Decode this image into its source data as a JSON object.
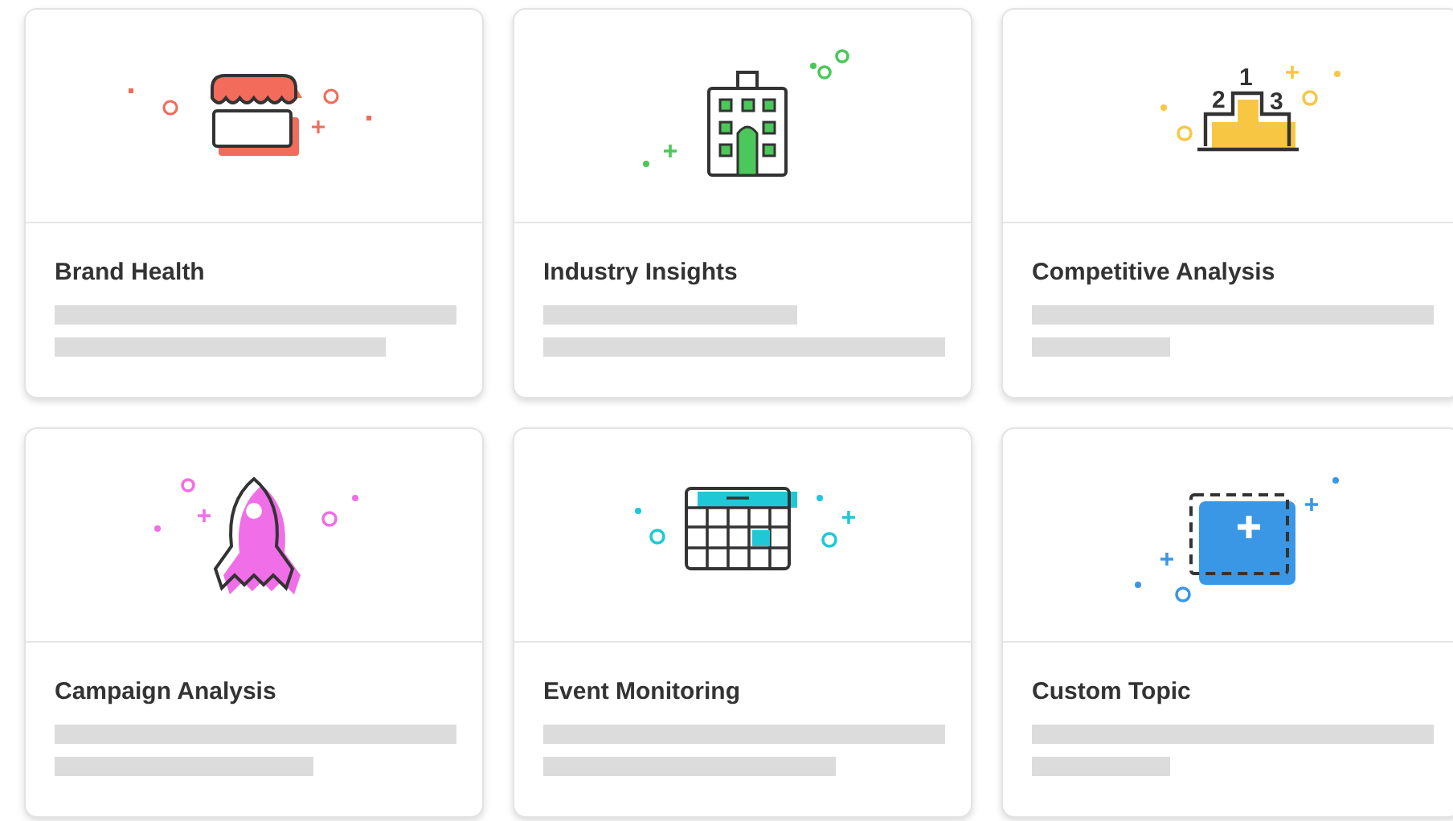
{
  "cards": [
    {
      "title": "Brand Health",
      "kind": "store",
      "color": "#f26b5b"
    },
    {
      "title": "Industry Insights",
      "kind": "building",
      "color": "#4cc75a"
    },
    {
      "title": "Competitive Analysis",
      "kind": "podium",
      "color": "#f7c744",
      "ranks": [
        "2",
        "1",
        "3"
      ]
    },
    {
      "title": "Campaign Analysis",
      "kind": "rocket",
      "color": "#f06ee8"
    },
    {
      "title": "Event Monitoring",
      "kind": "calendar",
      "color": "#1fc8d6"
    },
    {
      "title": "Custom Topic",
      "kind": "add",
      "color": "#3a97e6"
    }
  ]
}
